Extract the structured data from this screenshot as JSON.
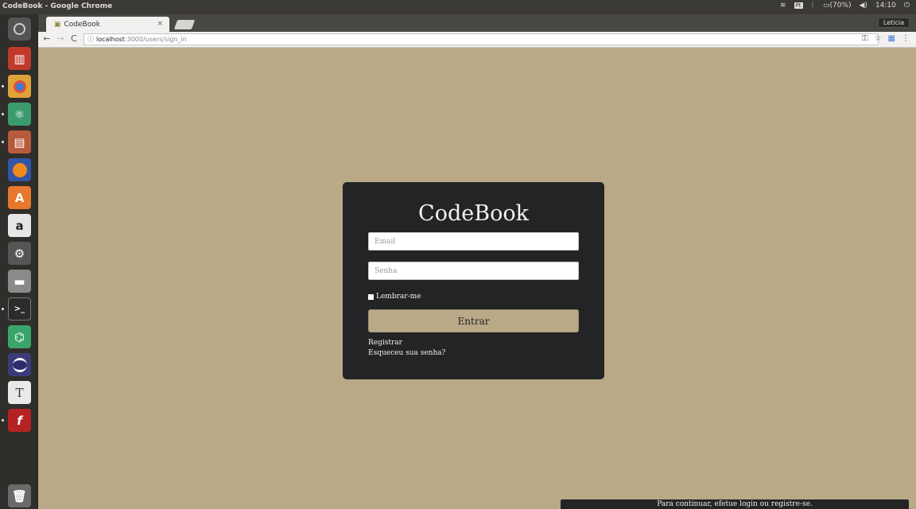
{
  "window": {
    "title": "CodeBook - Google Chrome"
  },
  "indicators": {
    "keyboard": "Pt",
    "battery": "(70%)",
    "time": "14:10"
  },
  "tab": {
    "title": "CodeBook",
    "close": "×"
  },
  "profile": {
    "name": "Leticia"
  },
  "address": {
    "host": "localhost",
    "path": ":3000/users/sign_in"
  },
  "login": {
    "brand": "CodeBook",
    "email_placeholder": "Email",
    "password_placeholder": "Senha",
    "remember_label": "Lembrar-me",
    "submit_label": "Entrar",
    "register_link": "Registrar",
    "forgot_link": "Esqueceu sua senha?"
  },
  "flash": {
    "message": "Para continuar, efetue login ou registre-se."
  },
  "colors": {
    "page_bg": "#baa987",
    "card_bg": "#222426"
  },
  "launcher_icons": [
    "ubuntu-logo-icon",
    "popcorn-icon",
    "chrome-icon",
    "atom-icon",
    "files-icon",
    "firefox-icon",
    "software-center-icon",
    "amazon-icon",
    "settings-icon",
    "drive-icon",
    "terminal-icon",
    "android-studio-icon",
    "eclipse-icon",
    "text-editor-icon",
    "flash-icon",
    "trash-icon"
  ]
}
